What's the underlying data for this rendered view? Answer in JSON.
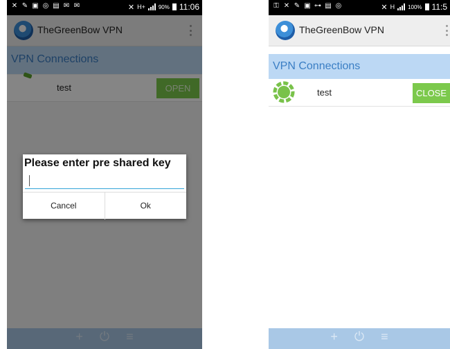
{
  "left": {
    "status": {
      "network": "H+",
      "battery": "90%",
      "time": "11:06"
    },
    "app_title": "TheGreenBow VPN",
    "section_title": "VPN Connections",
    "connection": {
      "name": "test",
      "button": "OPEN"
    },
    "dialog": {
      "title": "Please enter pre shared key",
      "input_value": "",
      "cancel": "Cancel",
      "ok": "Ok"
    }
  },
  "right": {
    "status": {
      "network": "H",
      "battery": "100%",
      "time": "11:5"
    },
    "app_title": "TheGreenBow VPN",
    "section_title": "VPN Connections",
    "connection": {
      "name": "test",
      "button": "CLOSE"
    }
  },
  "colors": {
    "accent_blue": "#3a7ec4",
    "header_bg": "#bcd8f4",
    "green": "#7cc94c",
    "input_line": "#33a3d8"
  },
  "icons": {
    "status_left": [
      "missed-call-icon",
      "tools-icon",
      "message-icon",
      "sync-icon",
      "clipboard-icon",
      "email-icon",
      "mail-icon",
      "mute-icon"
    ],
    "status_right": [
      "key-icon",
      "missed-call-icon",
      "tools-icon",
      "message-icon",
      "vpn-key-icon",
      "clipboard-icon",
      "sync-icon",
      "mute-icon"
    ],
    "bottom": [
      "add-icon",
      "power-icon",
      "menu-icon"
    ]
  }
}
